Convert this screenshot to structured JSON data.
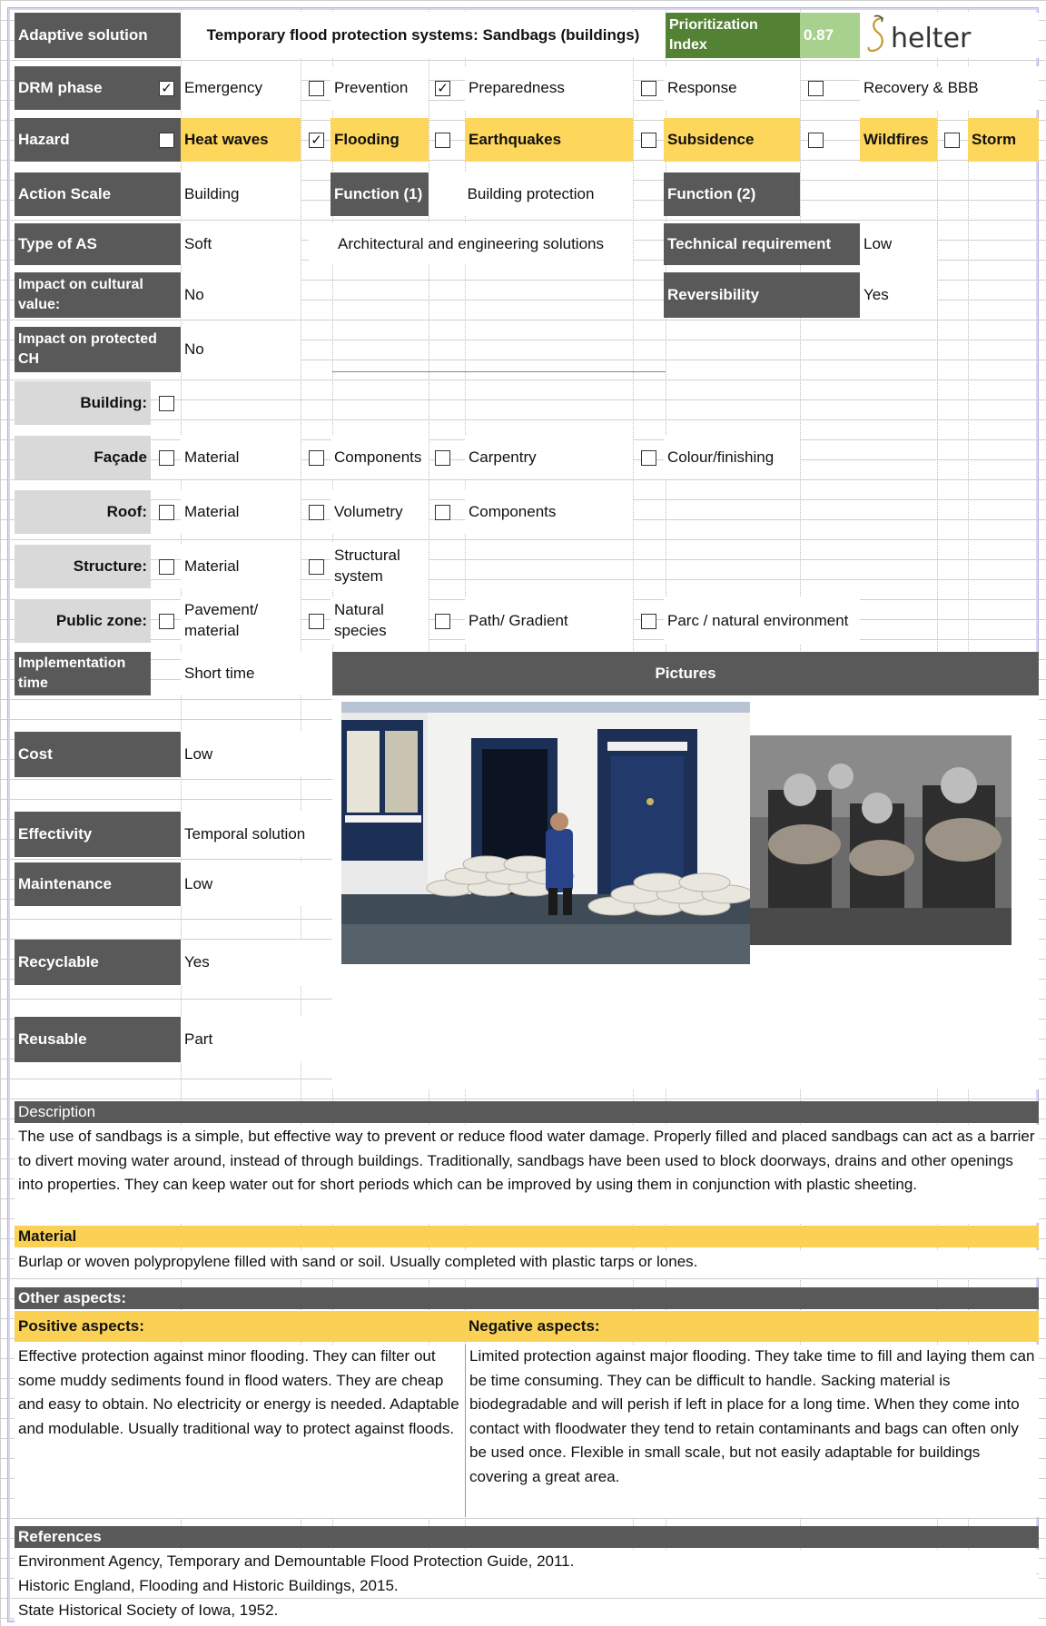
{
  "header": {
    "adaptive_solution_label": "Adaptive solution",
    "title": "Temporary flood protection systems: Sandbags (buildings)",
    "prioritization_label": "Prioritization Index",
    "prioritization_value": "0.87",
    "logo_text": "Shelter"
  },
  "drm": {
    "label": "DRM phase",
    "items": [
      {
        "label": "Emergency",
        "checked": true
      },
      {
        "label": "Prevention",
        "checked": false
      },
      {
        "label": "Preparedness",
        "checked": true
      },
      {
        "label": "Response",
        "checked": false
      },
      {
        "label": "Recovery & BBB",
        "checked": false
      }
    ]
  },
  "hazard": {
    "label": "Hazard",
    "items": [
      {
        "label": "Heat waves",
        "checked": false
      },
      {
        "label": "Flooding",
        "checked": true
      },
      {
        "label": "Earthquakes",
        "checked": false
      },
      {
        "label": "Subsidence",
        "checked": false
      },
      {
        "label": "Wildfires",
        "checked": false
      },
      {
        "label": "Storm",
        "checked": false
      }
    ]
  },
  "fields": {
    "action_scale_label": "Action Scale",
    "action_scale": "Building",
    "function1_label": "Function (1)",
    "function1": "Building protection",
    "function2_label": "Function (2)",
    "type_label": "Type of AS",
    "type": "Soft",
    "type_detail": "Architectural and engineering solutions",
    "tech_label": "Technical requirement",
    "tech": "Low",
    "cultural_label": "Impact on cultural value:",
    "cultural": "No",
    "reversibility_label": "Reversibility",
    "reversibility": "Yes",
    "protected_label": "Impact on protected CH",
    "protected": "No"
  },
  "elements": {
    "building_label": "Building:",
    "facade_label": "Façade",
    "facade_items": [
      "Material",
      "Components",
      "Carpentry",
      "Colour/finishing"
    ],
    "roof_label": "Roof:",
    "roof_items": [
      "Material",
      "Volumetry",
      "Components"
    ],
    "structure_label": "Structure:",
    "structure_items": [
      "Material",
      "Structural system"
    ],
    "public_label": "Public zone:",
    "public_items": [
      "Pavement/ material",
      "Natural species",
      "Path/ Gradient",
      "Parc / natural environment"
    ]
  },
  "impl": {
    "time_label": "Implementation time",
    "time": "Short time",
    "pictures_label": "Pictures",
    "cost_label": "Cost",
    "cost": "Low",
    "effectivity_label": "Effectivity",
    "effectivity": "Temporal solution",
    "maintenance_label": "Maintenance",
    "maintenance": "Low",
    "recyclable_label": "Recyclable",
    "recyclable": "Yes",
    "reusable_label": "Reusable",
    "reusable": "Part"
  },
  "description": {
    "label": "Description",
    "text": "The use of sandbags is a simple, but effective way to prevent or reduce flood water damage. Properly filled and placed sandbags can act as a barrier to divert moving water around, instead of through buildings. Traditionally, sandbags have been used to block doorways, drains and other openings into properties. They can keep water out for short periods which can be improved by using them in conjunction with plastic sheeting."
  },
  "material": {
    "label": "Material",
    "text": "Burlap or woven polypropylene filled with sand or soil. Usually completed with plastic tarps or lones."
  },
  "other": {
    "label": "Other aspects:",
    "positive_label": "Positive aspects:",
    "negative_label": "Negative aspects:",
    "positive": "Effective protection against minor flooding. They can filter out some muddy sediments found in flood waters. They are cheap and easy to obtain. No electricity or energy is needed. Adaptable and modulable. Usually traditional way to protect against floods.",
    "negative": "Limited protection against major flooding. They take time to fill and laying them can be time consuming. They can be difficult to handle. Sacking material is biodegradable and will perish if left in place for a long time. When they come into contact with floodwater they tend to retain contaminants and bags can often only be used once. Flexible in small scale, but not easily adaptable for buildings covering a great area."
  },
  "references": {
    "label": "References",
    "items": [
      "Environment Agency, Temporary and Demountable Flood Protection Guide, 2011.",
      "Historic England, Flooding and Historic Buildings, 2015.",
      "State Historical Society of Iowa, 1952."
    ]
  },
  "colors": {
    "label_bg": "#595959",
    "accent_green": "#548235",
    "light_green": "#a9d18e",
    "highlight_yellow": "#fdd65c",
    "section_grey": "#d9d9d9"
  }
}
